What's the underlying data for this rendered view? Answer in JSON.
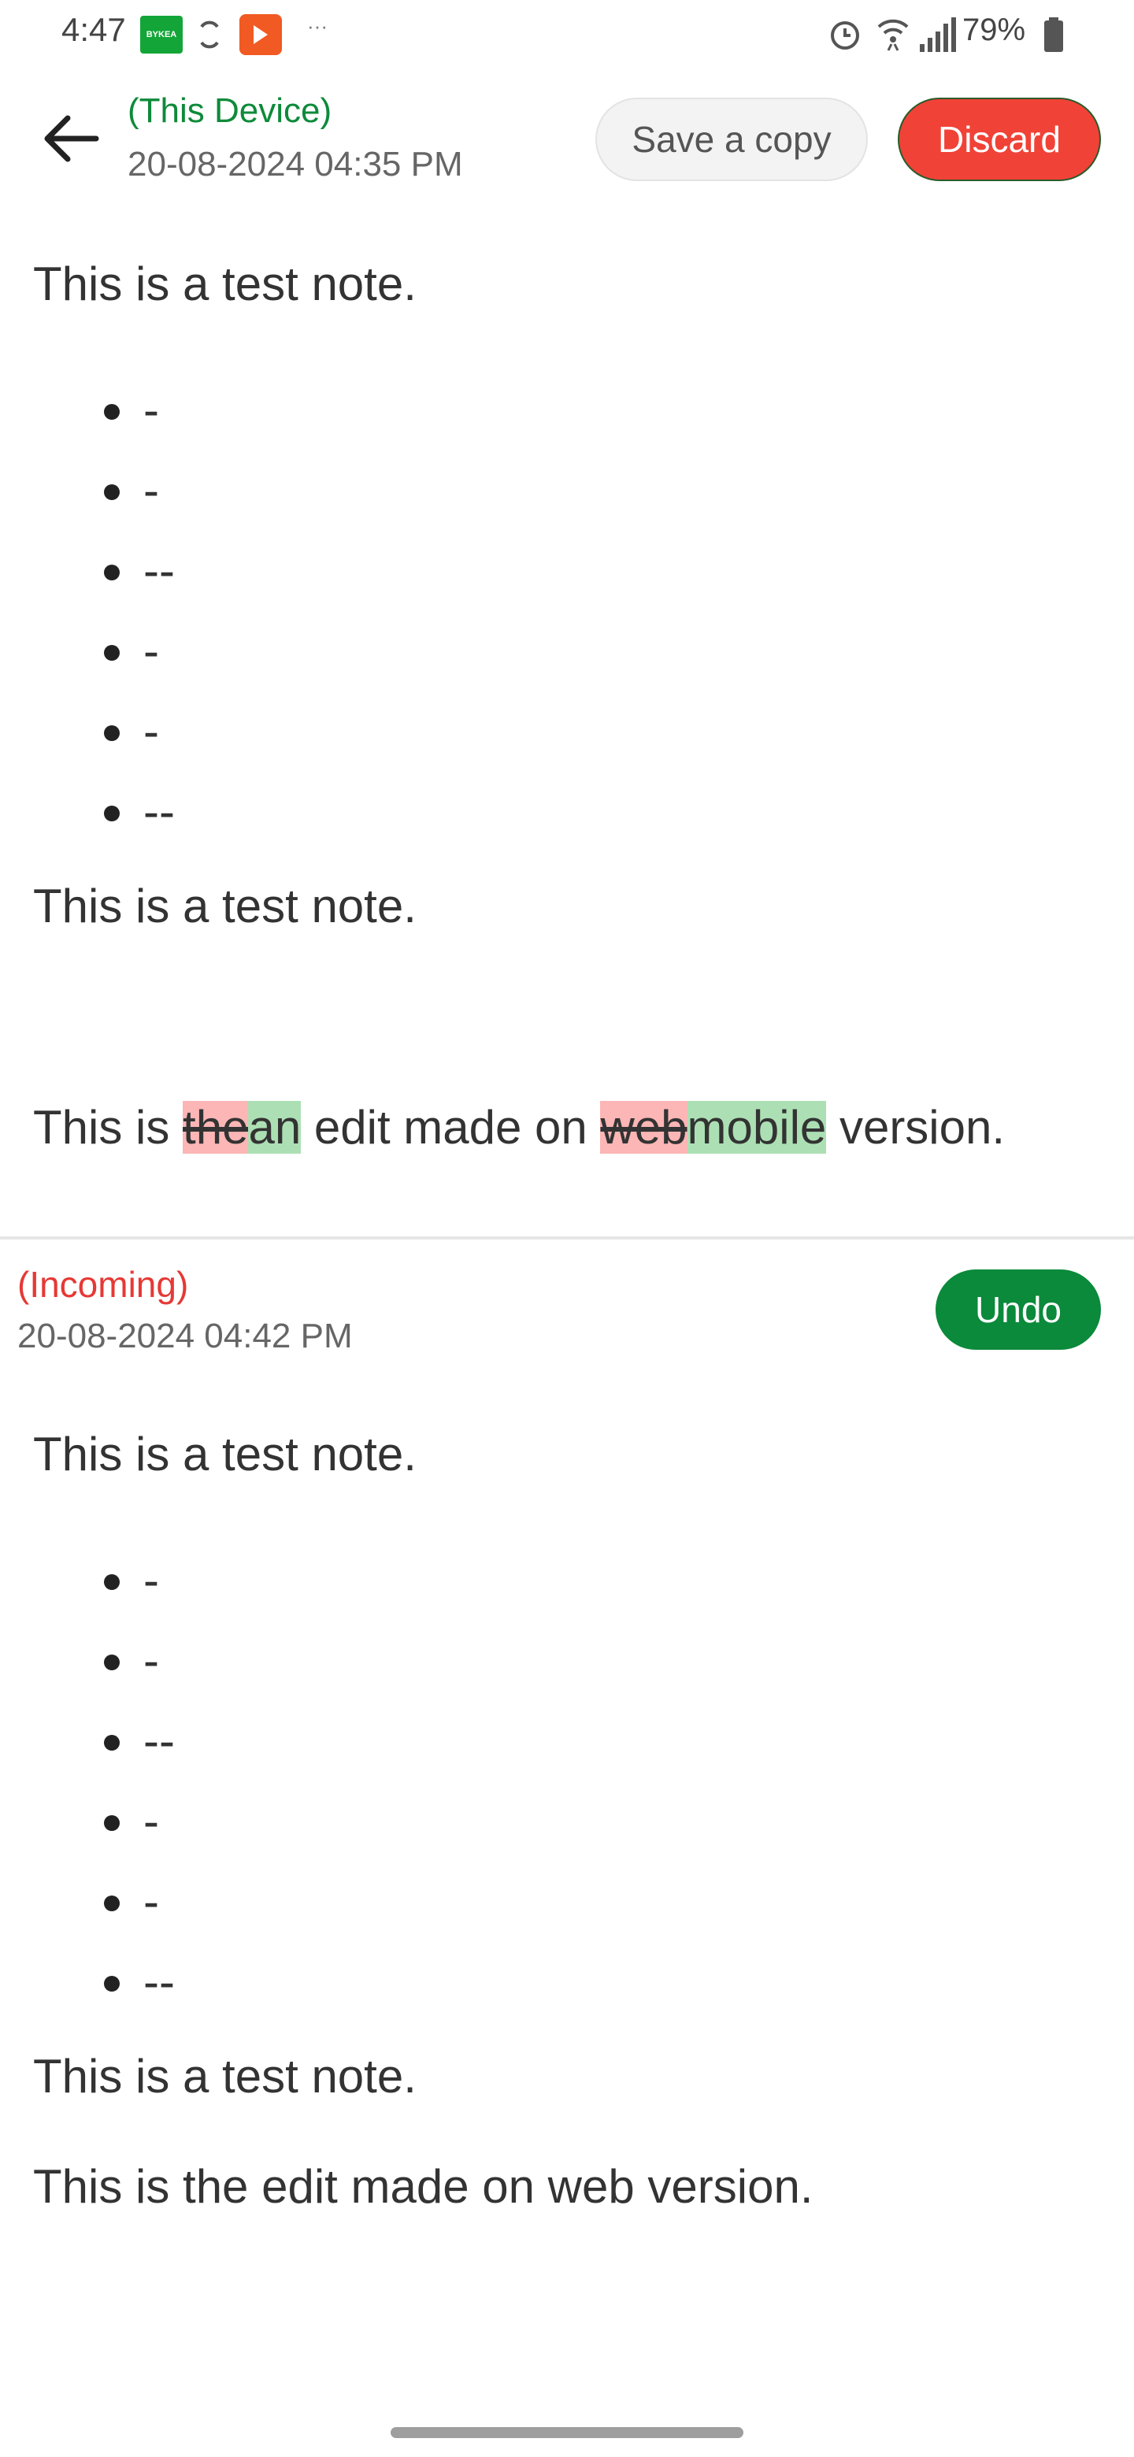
{
  "status_bar": {
    "time": "4:47",
    "bykea_label": "BYKEA",
    "more": "···",
    "battery": "79%"
  },
  "header": {
    "title": "(This Device)",
    "date": "20-08-2024 04:35 PM",
    "save_copy_label": "Save a copy",
    "discard_label": "Discard"
  },
  "local_note": {
    "para1": "This is a test note.",
    "bullets": [
      "-",
      "-",
      "--",
      "-",
      "-",
      "--"
    ],
    "para2": "This is a test note.",
    "edit_line": {
      "prefix": "This is ",
      "del1": "the",
      "ins1": "an",
      "middle": " edit made on ",
      "del2": "web",
      "ins2": "mobile",
      "suffix": " version."
    }
  },
  "incoming": {
    "title": "(Incoming)",
    "date": "20-08-2024 04:42 PM",
    "undo_label": "Undo",
    "para1": "This is a test note.",
    "bullets": [
      "-",
      "-",
      "--",
      "-",
      "-",
      "--"
    ],
    "para2": "This is a test note.",
    "para3": "This is the edit made on web version."
  },
  "colors": {
    "this_device": "#0e8a3a",
    "incoming": "#e53935",
    "discard": "#f14237",
    "undo": "#0a8a3a",
    "deleted_highlight": "#fbb6b5",
    "inserted_highlight": "#ace0b4"
  }
}
